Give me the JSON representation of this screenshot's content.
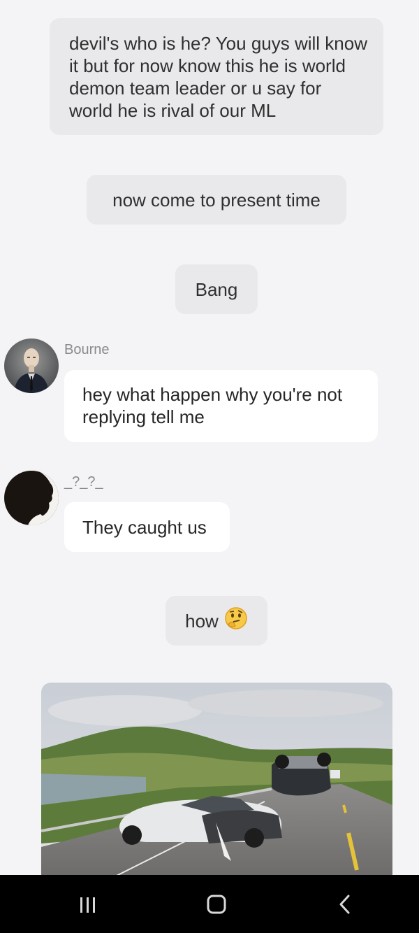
{
  "messages": {
    "narration_1": "devil's who is he? You guys will know it but for now know this he is world demon team leader or u say for world he is rival of our ML",
    "narration_2": "now come to present time",
    "narration_3": "Bang",
    "bourne": {
      "sender": "Bourne",
      "text": "hey what happen why you're not replying tell me"
    },
    "unknown": {
      "sender": "_?_?_",
      "text": "They caught us"
    },
    "narration_4": {
      "text": "how",
      "emoji": "🤔"
    }
  },
  "attachment": {
    "type": "image",
    "description_icon": "car-crash-photo"
  },
  "navbar": {
    "recent_icon": "recent-apps-icon",
    "home_icon": "home-icon",
    "back_icon": "back-icon"
  },
  "colors": {
    "background": "#f4f4f6",
    "narration_bubble": "#e9e9eb",
    "message_bubble": "#ffffff",
    "navbar": "#000000"
  }
}
